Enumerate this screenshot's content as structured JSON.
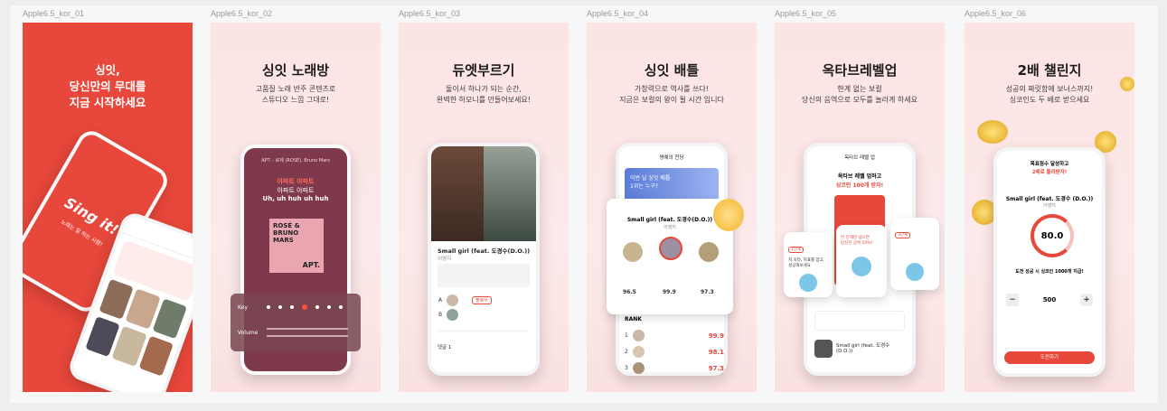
{
  "frames": [
    {
      "label": "Apple6.5_kor_01",
      "hero": "싱잇,\n당신만의 무대를\n지금 시작하세요",
      "logo": "Sing it!",
      "logo_sub": "노래는 잘 하는 사람!"
    },
    {
      "label": "Apple6.5_kor_02",
      "title": "싱잇 노래방",
      "subtitle": "고품질 노래 반주 콘텐츠로\n스튜디오 느낌 그대로!",
      "now_playing": "APT. - 로제 (ROSÉ), Bruno Mars",
      "lyric_red": "아파트 아파트",
      "lyric_2": "아파트 아파트",
      "lyric_3": "Uh, uh huh uh huh",
      "album_text": "ROSÉ & BRUNO MARS",
      "album_apt": "APT.",
      "key_label": "Key",
      "volume_label": "Volume"
    },
    {
      "label": "Apple6.5_kor_03",
      "title": "듀엣부르기",
      "subtitle": "둘이서 하나가 되는 순간,\n완벽한 하모니를 만들어보세요!",
      "song": "Small girl (feat. 도경수(D.O.))",
      "artist": "이영지",
      "part_a": "A",
      "part_b": "B",
      "follow": "팔로우",
      "comment_label": "댓글 1"
    },
    {
      "label": "Apple6.5_kor_04",
      "title": "싱잇 배틀",
      "subtitle": "가창력으로 역사를 쓰다!\n지금은 보컬의 왕이 될 시간 입니다",
      "header": "명예의 전당",
      "banner": "이번 달 싱잇 배틀\n1위는 누구?",
      "song": "Small girl (feat. 도경수(D.O.))",
      "artist": "이영지",
      "top_scores": [
        "96.5",
        "99.9",
        "97.3"
      ],
      "rank_label": "RANK",
      "ranks": [
        {
          "n": "1",
          "score": "99.9"
        },
        {
          "n": "2",
          "score": "98.1"
        },
        {
          "n": "3",
          "score": "97.3"
        }
      ]
    },
    {
      "label": "Apple6.5_kor_05",
      "title": "옥타브레벨업",
      "subtitle": "한계 없는 보컬\n당신의 음역으로 모두를 놀라게 하세요",
      "header": "옥타브 레벨 업",
      "card_title": "옥타브 레벨 업하고",
      "card_red": "싱코인 100개 받자!",
      "left_badge": "1단계",
      "left_text": "저 옥타, 목표를 잡고\n성공해보세요",
      "right_badge": "3단계",
      "mid_text": "한 단계만 넘으면\n당신은 상위 10%!",
      "song": "Small girl (feat. 도경수 (D.O.))"
    },
    {
      "label": "Apple6.5_kor_06",
      "title": "2배 챌린지",
      "subtitle": "성공의 짜릿함에 보너스까지!\n싱코인도 두 배로 받으세요",
      "goal_text": "목표점수 달성하고",
      "goal_red": "2배로 돌려받자!",
      "song": "Small girl (feat. 도경수 (D.O.))",
      "artist": "이영지",
      "score": "80.0",
      "challenge": "도전 성공 시 싱코인 1000개 지급!",
      "amount": "500",
      "minus": "−",
      "plus": "+",
      "cta": "도전하기"
    }
  ]
}
